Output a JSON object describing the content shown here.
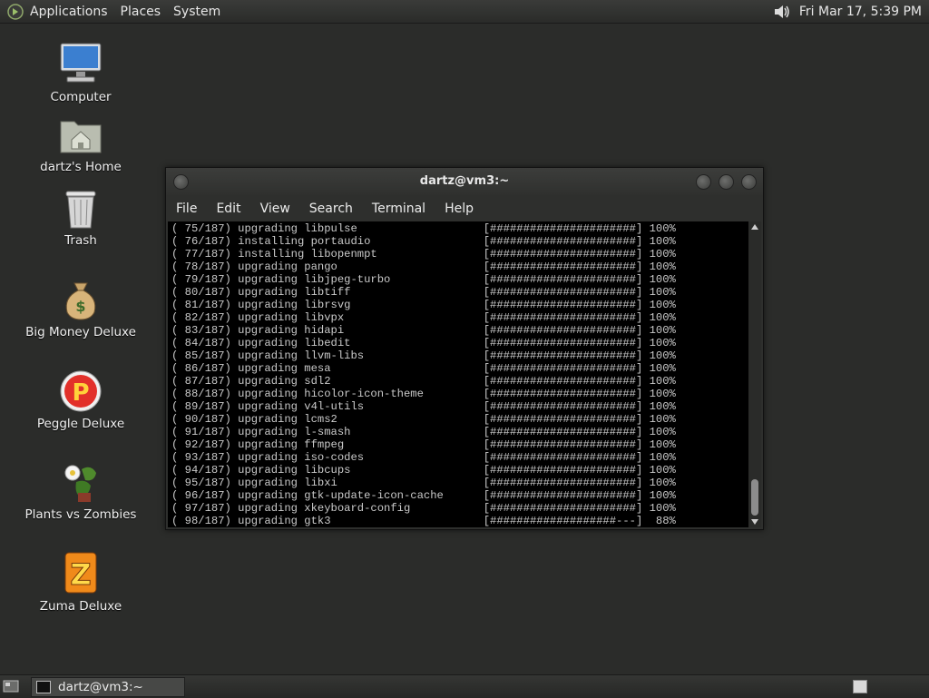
{
  "top_panel": {
    "menus": [
      "Applications",
      "Places",
      "System"
    ],
    "clock": "Fri Mar 17,  5:39 PM"
  },
  "desktop_icons": [
    {
      "label": "Computer",
      "icon": "computer-icon"
    },
    {
      "label": "dartz's Home",
      "icon": "home-folder-icon"
    },
    {
      "label": "Trash",
      "icon": "trash-icon"
    },
    {
      "label": "Big Money Deluxe",
      "icon": "money-bag-icon"
    },
    {
      "label": "Peggle Deluxe",
      "icon": "peggle-icon"
    },
    {
      "label": "Plants vs Zombies",
      "icon": "plants-vs-zombies-icon"
    },
    {
      "label": "Zuma Deluxe",
      "icon": "zuma-icon"
    }
  ],
  "terminal": {
    "title": "dartz@vm3:~",
    "menus": [
      "File",
      "Edit",
      "View",
      "Search",
      "Terminal",
      "Help"
    ],
    "lines": [
      "( 75/187) upgrading libpulse                   [######################] 100%",
      "( 76/187) installing portaudio                 [######################] 100%",
      "( 77/187) installing libopenmpt                [######################] 100%",
      "( 78/187) upgrading pango                      [######################] 100%",
      "( 79/187) upgrading libjpeg-turbo              [######################] 100%",
      "( 80/187) upgrading libtiff                    [######################] 100%",
      "( 81/187) upgrading librsvg                    [######################] 100%",
      "( 82/187) upgrading libvpx                     [######################] 100%",
      "( 83/187) upgrading hidapi                     [######################] 100%",
      "( 84/187) upgrading libedit                    [######################] 100%",
      "( 85/187) upgrading llvm-libs                  [######################] 100%",
      "( 86/187) upgrading mesa                       [######################] 100%",
      "( 87/187) upgrading sdl2                       [######################] 100%",
      "( 88/187) upgrading hicolor-icon-theme         [######################] 100%",
      "( 89/187) upgrading v4l-utils                  [######################] 100%",
      "( 90/187) upgrading lcms2                      [######################] 100%",
      "( 91/187) upgrading l-smash                    [######################] 100%",
      "( 92/187) upgrading ffmpeg                     [######################] 100%",
      "( 93/187) upgrading iso-codes                  [######################] 100%",
      "( 94/187) upgrading libcups                    [######################] 100%",
      "( 95/187) upgrading libxi                      [######################] 100%",
      "( 96/187) upgrading gtk-update-icon-cache      [######################] 100%",
      "( 97/187) upgrading xkeyboard-config           [######################] 100%",
      "( 98/187) upgrading gtk3                       [###################---]  88%"
    ]
  },
  "taskbar": {
    "task_label": "dartz@vm3:~"
  }
}
